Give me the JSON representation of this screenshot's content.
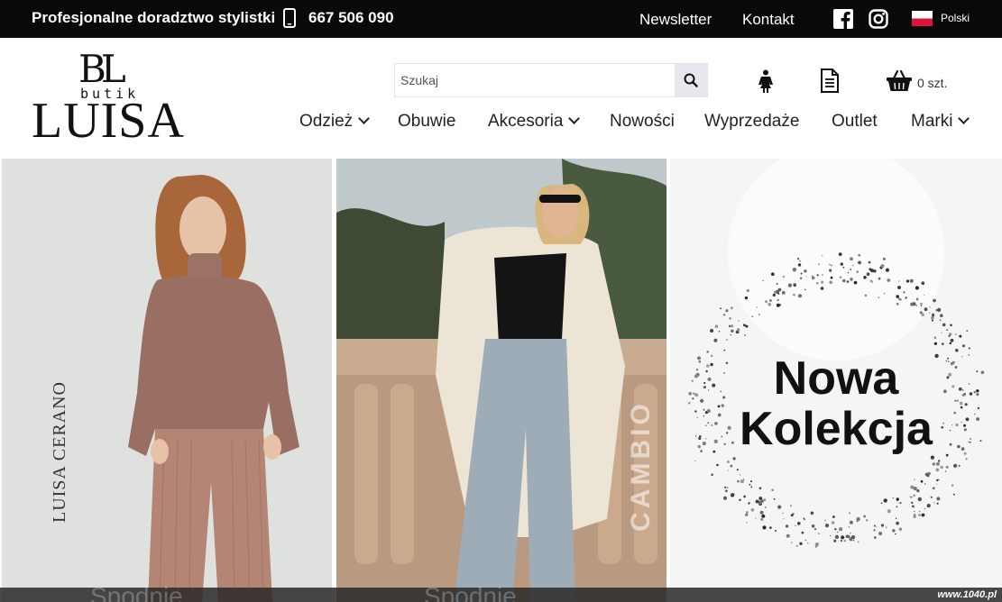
{
  "topbar": {
    "advice": "Profesjonalne doradztwo stylistki",
    "phone": "667 506 090",
    "newsletter": "Newsletter",
    "contact": "Kontakt",
    "language": "Polski"
  },
  "logo": {
    "monogram": "BL",
    "subtitle": "butik",
    "name": "LUISA"
  },
  "search": {
    "placeholder": "Szukaj"
  },
  "cart": {
    "count": "0 szt."
  },
  "nav": {
    "items": [
      {
        "label": "Odzież",
        "has_dropdown": true
      },
      {
        "label": "Obuwie",
        "has_dropdown": false
      },
      {
        "label": "Akcesoria",
        "has_dropdown": true
      },
      {
        "label": "Nowości",
        "has_dropdown": false
      },
      {
        "label": "Wyprzedaże",
        "has_dropdown": false
      },
      {
        "label": "Outlet",
        "has_dropdown": false
      },
      {
        "label": "Marki",
        "has_dropdown": true
      }
    ]
  },
  "banners": [
    {
      "brand": "LUISA CERANO",
      "caption": "Spodnie"
    },
    {
      "brand": "CAMBIO",
      "caption": "Spodnie"
    },
    {
      "headline_1": "Nowa",
      "headline_2": "Kolekcja"
    }
  ],
  "watermark": "www.1040.pl",
  "colors": {
    "topbar_bg": "#0a0a0a",
    "text": "#222222",
    "flag_white": "#ffffff",
    "flag_red": "#dc143c"
  }
}
